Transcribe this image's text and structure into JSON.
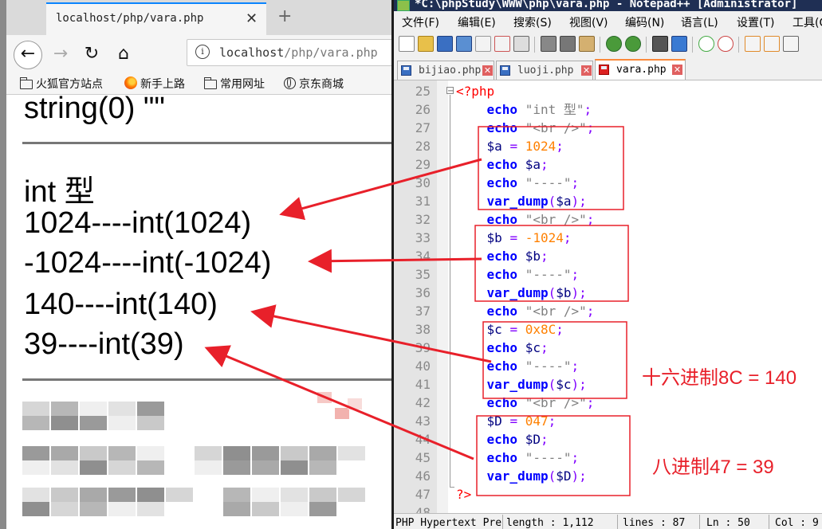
{
  "browser": {
    "tab_title": "localhost/php/vara.php",
    "tab_close": "✕",
    "new_tab": "+",
    "nav": {
      "back": "←",
      "forward": "→",
      "reload": "↻",
      "home": "⌂"
    },
    "url_host": "localhost",
    "url_path": "/php/vara.php",
    "info_icon": "i",
    "bookmarks": [
      "火狐官方站点",
      "新手上路",
      "常用网址",
      "京东商城"
    ],
    "output_lines": [
      "string(0) \"\"",
      "int 型",
      "1024----int(1024)",
      "-1024----int(-1024)",
      "140----int(140)",
      "39----int(39)"
    ]
  },
  "notepad": {
    "title": "*C:\\phpStudy\\WWW\\php\\vara.php - Notepad++ [Administrator]",
    "menu": [
      "文件(F)",
      "编辑(E)",
      "搜索(S)",
      "视图(V)",
      "编码(N)",
      "语言(L)",
      "设置(T)",
      "工具(O)"
    ],
    "tabs": [
      {
        "label": "bijiao.php",
        "close": "✕"
      },
      {
        "label": "luoji.php",
        "close": "✕"
      },
      {
        "label": "vara.php",
        "close": "✕"
      }
    ],
    "line_numbers": [
      "25",
      "26",
      "27",
      "28",
      "29",
      "30",
      "31",
      "32",
      "33",
      "34",
      "35",
      "36",
      "37",
      "38",
      "39",
      "40",
      "41",
      "42",
      "43",
      "44",
      "45",
      "46",
      "47",
      "48"
    ],
    "code_lines": [
      "<?php",
      "    echo \"int 型\";",
      "    echo \"<br />\";",
      "    $a = 1024;",
      "    echo $a;",
      "    echo \"----\";",
      "    var_dump($a);",
      "    echo \"<br />\";",
      "    $b = -1024;",
      "    echo $b;",
      "    echo \"----\";",
      "    var_dump($b);",
      "    echo \"<br />\";",
      "    $c = 0x8C;",
      "    echo $c;",
      "    echo \"----\";",
      "    var_dump($c);",
      "    echo \"<br />\";",
      "    $D = 047;",
      "    echo $D;",
      "    echo \"----\";",
      "    var_dump($D);",
      "?>"
    ],
    "fold_marker": "−",
    "status": {
      "lang": "PHP Hypertext Preprocessor file",
      "length": "length : 1,112",
      "lines": "lines : 87",
      "ln": "Ln : 50",
      "col": "Col : 9"
    }
  },
  "annotations": {
    "hex_note": "十六进制8C = 140",
    "oct_note": "八进制47 = 39",
    "arrow_color": "#e8202a"
  }
}
